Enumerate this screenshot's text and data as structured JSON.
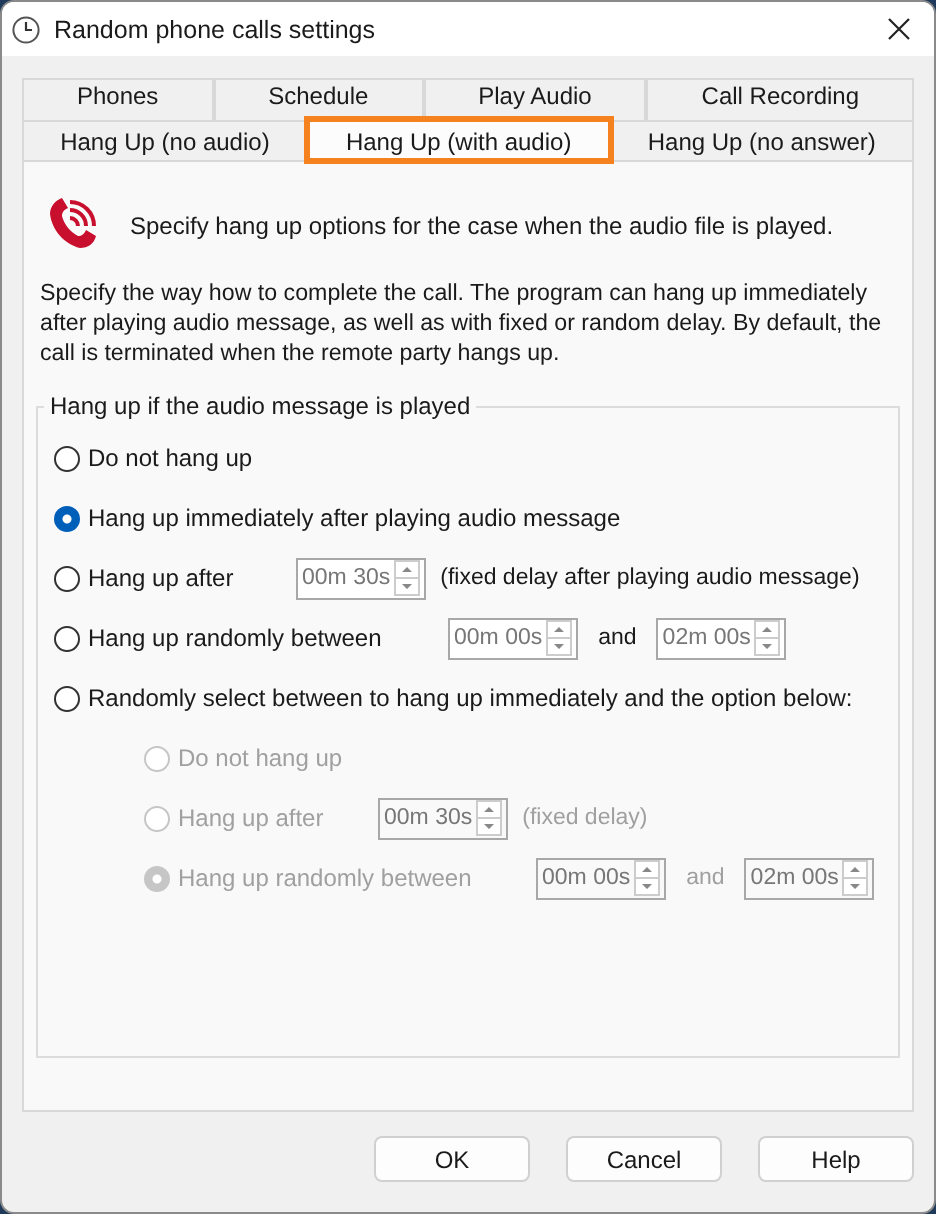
{
  "window": {
    "title": "Random phone calls settings"
  },
  "tab_rows": [
    [
      {
        "label": "Phones",
        "selected": false,
        "highlighted": false
      },
      {
        "label": "Schedule",
        "selected": false,
        "highlighted": false
      },
      {
        "label": "Play Audio",
        "selected": false,
        "highlighted": false
      },
      {
        "label": "Call Recording",
        "selected": false,
        "highlighted": false
      }
    ],
    [
      {
        "label": "Hang Up (no audio)",
        "selected": false,
        "highlighted": false
      },
      {
        "label": "Hang Up (with audio)",
        "selected": true,
        "highlighted": true
      },
      {
        "label": "Hang Up (no answer)",
        "selected": false,
        "highlighted": false
      }
    ]
  ],
  "header": "Specify hang up options for the case when the audio file is played.",
  "description": "Specify the way how to complete the call. The program can hang up immediately after playing audio message, as well as with fixed or random delay. By default, the call is terminated when the remote party hangs up.",
  "group": {
    "title": "Hang up if the audio message is played",
    "options": [
      {
        "kind": "plain",
        "label": "Do not hang up",
        "selected": false
      },
      {
        "kind": "plain",
        "label": "Hang up immediately after playing audio message",
        "selected": true
      },
      {
        "kind": "delay",
        "label": "Hang up after",
        "selected": false,
        "value": "00m 30s",
        "note": "(fixed delay after playing audio message)"
      },
      {
        "kind": "range",
        "label": "Hang up randomly between",
        "selected": false,
        "from": "00m 00s",
        "joiner": "and",
        "to": "02m 00s"
      },
      {
        "kind": "plain",
        "label": "Randomly select between to hang up immediately and the option below:",
        "selected": false
      }
    ],
    "sub_options": [
      {
        "kind": "plain",
        "label": "Do not hang up",
        "selected": false,
        "disabled": true
      },
      {
        "kind": "delay",
        "label": "Hang up after",
        "selected": false,
        "disabled": true,
        "value": "00m 30s",
        "note": "(fixed delay)"
      },
      {
        "kind": "range",
        "label": "Hang up randomly between",
        "selected": true,
        "disabled": true,
        "from": "00m 00s",
        "joiner": "and",
        "to": "02m 00s"
      }
    ]
  },
  "buttons": [
    "OK",
    "Cancel",
    "Help"
  ]
}
